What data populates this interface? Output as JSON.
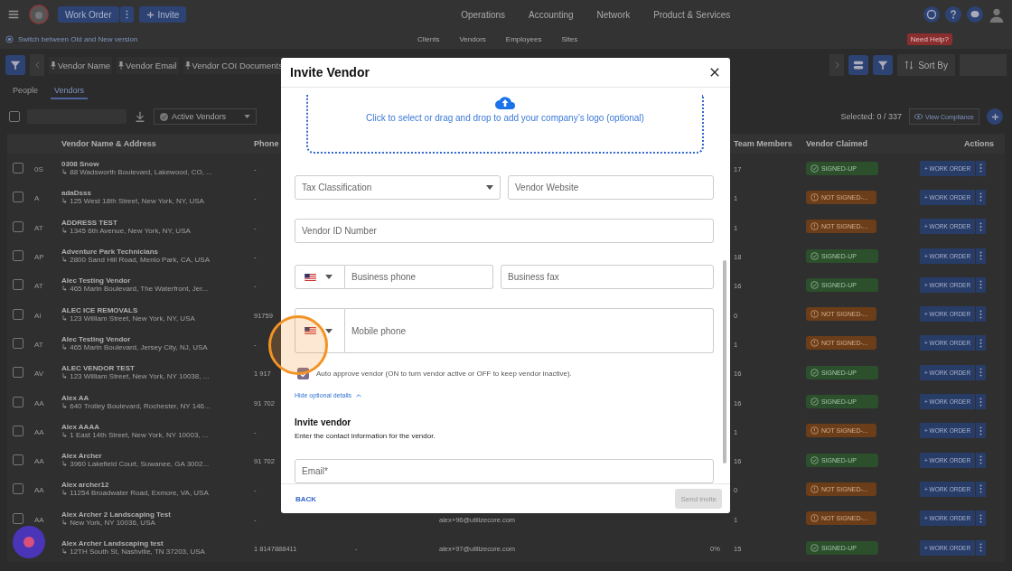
{
  "top_bar": {
    "work_order_button": "Work Order",
    "invite_button": "Invite",
    "nav": [
      "Operations",
      "Accounting",
      "Network",
      "Product & Services"
    ]
  },
  "sub_bar": {
    "switch_link": "Switch between Old and New version",
    "nav": [
      "Clients",
      "Vendors",
      "Employees",
      "Sites"
    ],
    "help_badge": "Need Help?"
  },
  "column_bar": {
    "pinned": [
      "Vendor Name",
      "Vendor Email",
      "Vendor COI Documents"
    ],
    "sort_button": "Sort By"
  },
  "tabs": [
    {
      "label": "People",
      "selected": false
    },
    {
      "label": "Vendors",
      "selected": true
    }
  ],
  "filters": {
    "select_all_checked": false,
    "status_select": "Active Vendors",
    "selected_count": "Selected: 0 / 337",
    "compliance_button": "View Compliance"
  },
  "table": {
    "columns": [
      "Vendor Name & Address",
      "Phone",
      "Team Members",
      "Vendor Claimed",
      "Actions"
    ],
    "rows": [
      {
        "checked": false,
        "initials": "0S",
        "name": "0308 Snow",
        "address": "↳ 88 Wadsworth Boulevard, Lakewood, CO, ...",
        "phone": "-",
        "team": "17",
        "signed_up": true,
        "claimed": "SIGNED-UP",
        "action": "+ WORK ORDER"
      },
      {
        "checked": false,
        "initials": "A",
        "name": "adaDsss",
        "address": "↳ 125 West 18th Street, New York, NY, USA",
        "phone": "-",
        "team": "1",
        "signed_up": false,
        "claimed": "NOT SIGNED-...",
        "action": "+ WORK ORDER"
      },
      {
        "checked": false,
        "initials": "AT",
        "name": "ADDRESS TEST",
        "address": "↳ 1345 6th Avenue, New York, NY, USA",
        "phone": "-",
        "team": "1",
        "signed_up": false,
        "claimed": "NOT SIGNED-...",
        "action": "+ WORK ORDER"
      },
      {
        "checked": false,
        "initials": "AP",
        "name": "Adventure Park Technicians",
        "address": "↳ 2800 Sand Hill Road, Menlo Park, CA, USA",
        "phone": "-",
        "team": "18",
        "signed_up": true,
        "claimed": "SIGNED-UP",
        "action": "+ WORK ORDER"
      },
      {
        "checked": false,
        "initials": "AT",
        "name": "Alec Testing Vendor",
        "address": "↳ 465 Marin Boulevard, The Waterfront, Jer...",
        "phone": "-",
        "team": "16",
        "signed_up": true,
        "claimed": "SIGNED-UP",
        "action": "+ WORK ORDER"
      },
      {
        "checked": false,
        "initials": "AI",
        "name": "ALEC ICE REMOVALS",
        "address": "↳ 123 William Street, New York, NY, USA",
        "phone": "91759",
        "team": "0",
        "signed_up": false,
        "claimed": "NOT SIGNED-...",
        "action": "+ WORK ORDER"
      },
      {
        "checked": false,
        "initials": "AT",
        "name": "Alec Testing Vendor",
        "address": "↳ 465 Marin Boulevard, Jersey City, NJ, USA",
        "phone": "-",
        "team": "1",
        "signed_up": false,
        "claimed": "NOT SIGNED-...",
        "action": "+ WORK ORDER"
      },
      {
        "checked": false,
        "initials": "AV",
        "name": "ALEC VENDOR TEST",
        "address": "↳ 123 William Street, New York, NY 10038, ...",
        "phone": "1 917",
        "team": "16",
        "signed_up": true,
        "claimed": "SIGNED-UP",
        "action": "+ WORK ORDER"
      },
      {
        "checked": false,
        "initials": "AA",
        "name": "Alex AA",
        "address": "↳ 640 Trolley Boulevard, Rochester, NY 146...",
        "phone": "91 702",
        "team": "16",
        "signed_up": true,
        "claimed": "SIGNED-UP",
        "action": "+ WORK ORDER"
      },
      {
        "checked": false,
        "initials": "AA",
        "name": "Alex AAAA",
        "address": "↳ 1 East 14th Street, New York, NY 10003, ...",
        "phone": "-",
        "team": "1",
        "signed_up": false,
        "claimed": "NOT SIGNED-...",
        "action": "+ WORK ORDER"
      },
      {
        "checked": false,
        "initials": "AA",
        "name": "Alex Archer",
        "address": "↳ 3960 Lakefield Court, Suwanee, GA 3002...",
        "phone": "91 702",
        "team": "16",
        "signed_up": true,
        "claimed": "SIGNED-UP",
        "action": "+ WORK ORDER"
      },
      {
        "checked": false,
        "initials": "AA",
        "name": "Alex archer12",
        "address": "↳ 11254 Broadwater Road, Exmore, VA, USA",
        "phone": "-",
        "team": "0",
        "signed_up": false,
        "claimed": "NOT SIGNED-...",
        "action": "+ WORK ORDER"
      },
      {
        "checked": false,
        "initials": "AA",
        "name": "Alex Archer 2 Landscaping Test",
        "address": "↳ New York, NY 10036, USA",
        "phone": "-",
        "email": "alex+96@utilizecore.com",
        "team": "1",
        "signed_up": false,
        "claimed": "NOT SIGNED-...",
        "action": "+ WORK ORDER"
      },
      {
        "name": "Alex Archer Landscaping test",
        "address": "↳ 12TH South St, Nashville, TN 37203, USA",
        "phone": "1 8147888411",
        "column_4": "-",
        "email": "alex+97@utilizecore.com",
        "column_7": "0%",
        "team": "15",
        "signed_up": true,
        "claimed": "SIGNED-UP",
        "action": "+ WORK ORDER"
      }
    ]
  },
  "dialog": {
    "title": "Invite Vendor",
    "upload_text": "Click to select or drag and drop to add your company’s logo (optional)",
    "tax_select": {
      "placeholder": "Tax Classification"
    },
    "website": {
      "placeholder": "Vendor Website"
    },
    "vendor_id": {
      "placeholder": "Vendor ID Number"
    },
    "business_phone": {
      "placeholder": "Business phone"
    },
    "business_fax": {
      "placeholder": "Business fax"
    },
    "mobile_phone": {
      "placeholder": "Mobile phone"
    },
    "auto_approve": {
      "label": "Auto approve vendor (ON to turn vendor active or OFF to keep vendor inactive).",
      "checked": true
    },
    "toggle_link": {
      "label": "Hide optional details",
      "expanded": true
    },
    "section_title": "Invite vendor",
    "section_text": "Enter the contact information for the vendor.",
    "email": {
      "placeholder": "Email*"
    },
    "back_button": "BACK",
    "send_button": {
      "label": "Send invite",
      "disabled": true
    }
  }
}
